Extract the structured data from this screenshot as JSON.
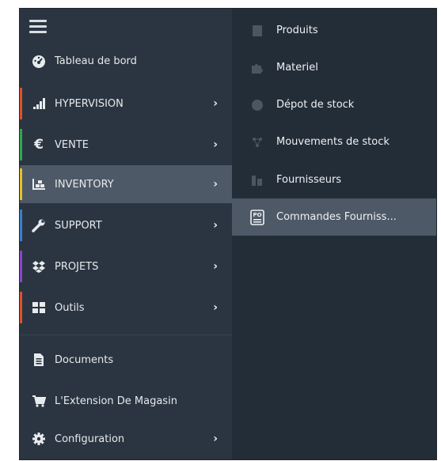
{
  "sidebar": {
    "items": [
      {
        "label": "Tableau de bord",
        "icon": "dashboard-icon",
        "accent": "",
        "chevron": false
      },
      {
        "label": "HYPERVISION",
        "icon": "signal-bars-icon",
        "accent": "#e0502a",
        "chevron": true
      },
      {
        "label": "VENTE",
        "icon": "euro-icon",
        "accent": "#2fa84f",
        "chevron": true
      },
      {
        "label": "INVENTORY",
        "icon": "inventory-icon",
        "accent": "#e8c020",
        "chevron": true,
        "active": true
      },
      {
        "label": "SUPPORT",
        "icon": "wrench-icon",
        "accent": "#3a7fd0",
        "chevron": true
      },
      {
        "label": "PROJETS",
        "icon": "dropbox-icon",
        "accent": "#8b45c8",
        "chevron": true
      },
      {
        "label": "Outils",
        "icon": "grid-icon",
        "accent": "#e0502a",
        "chevron": true
      },
      {
        "label": "Documents",
        "icon": "document-icon",
        "accent": "",
        "chevron": false
      },
      {
        "label": "L'Extension De Magasin",
        "icon": "cart-icon",
        "accent": "",
        "chevron": false
      },
      {
        "label": "Configuration",
        "icon": "gear-icon",
        "accent": "",
        "chevron": true
      }
    ],
    "chevron": "›"
  },
  "submenu": {
    "items": [
      {
        "label": "Produits",
        "icon": "product-icon"
      },
      {
        "label": "Materiel",
        "icon": "puzzle-icon"
      },
      {
        "label": "Dépot de stock",
        "icon": "warehouse-icon"
      },
      {
        "label": "Mouvements de stock",
        "icon": "movement-icon"
      },
      {
        "label": "Fournisseurs",
        "icon": "supplier-icon"
      },
      {
        "label": "Commandes Fourniss...",
        "icon": "purchase-order-icon",
        "active": true
      }
    ],
    "po_text": "PO"
  },
  "colors": {
    "sidebar_bg": "#2b3541",
    "submenu_bg": "#232d38",
    "active_bg": "#4d5966",
    "text": "#e6e9ec"
  }
}
